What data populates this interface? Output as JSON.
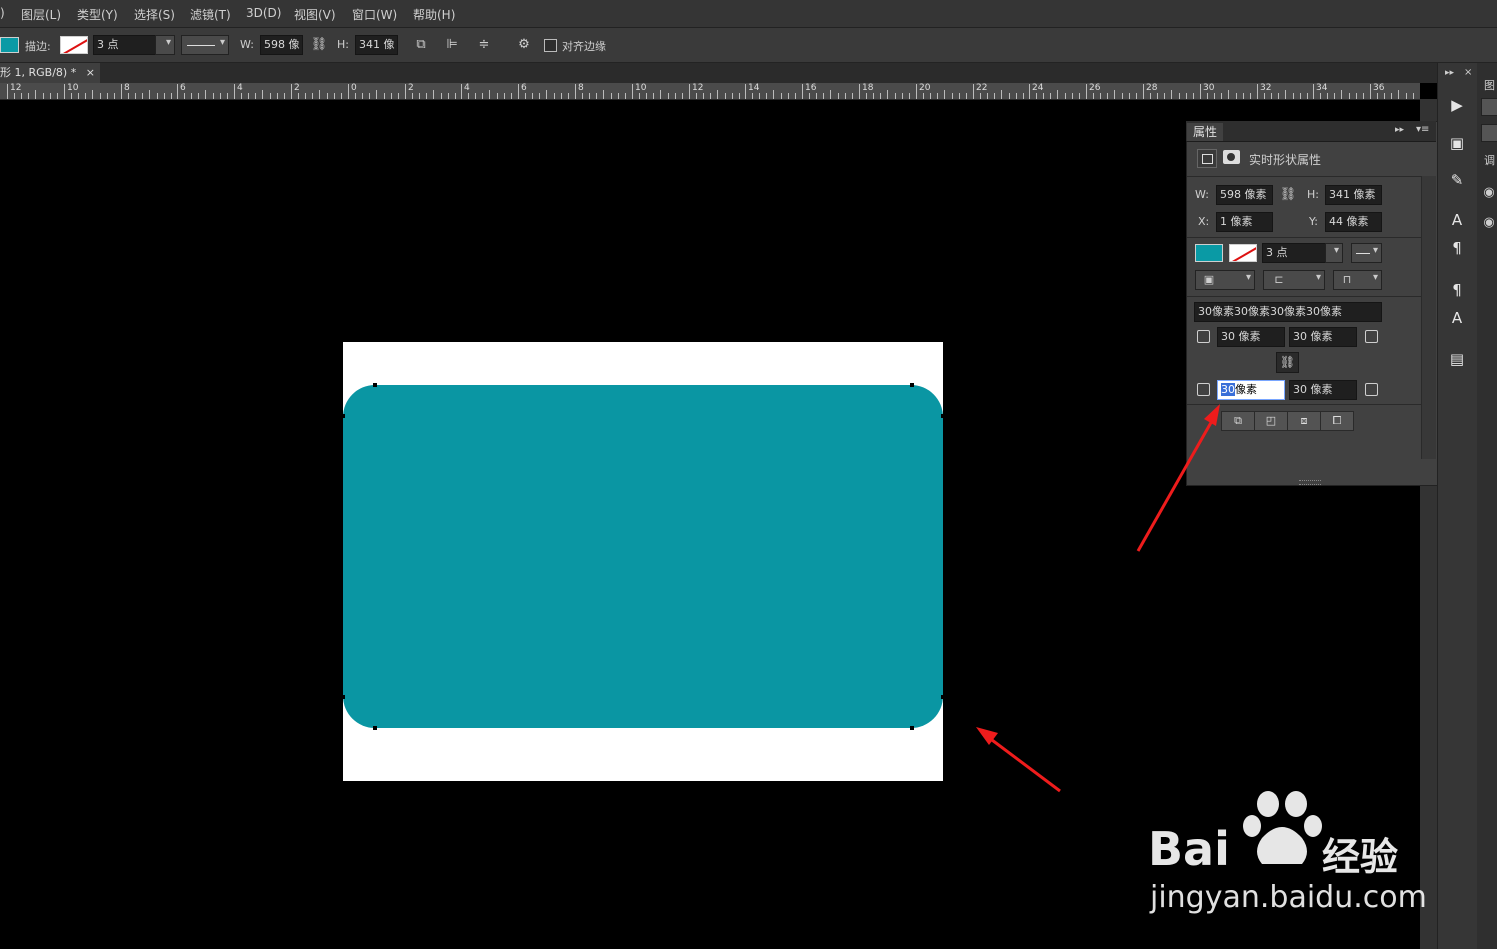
{
  "menu": {
    "items": [
      ")",
      "图层(L)",
      "类型(Y)",
      "选择(S)",
      "滤镜(T)",
      "3D(D)",
      "视图(V)",
      "窗口(W)",
      "帮助(H)"
    ]
  },
  "options": {
    "stroke_label": "描边:",
    "stroke_size": "3 点",
    "w_label": "W:",
    "w_value": "598 像",
    "h_label": "H:",
    "h_value": "341 像",
    "align_edges_label": "对齐边缘",
    "fill_color": "#0a9aa5"
  },
  "document": {
    "tab_title": "形 1, RGB/8) *",
    "close": "×",
    "shape_color": "#0a96a3"
  },
  "ruler": {
    "labels": [
      "12",
      "10",
      "8",
      "6",
      "4",
      "2",
      "0",
      "2",
      "4",
      "6",
      "8",
      "10",
      "12",
      "14",
      "16",
      "18",
      "20",
      "22",
      "24",
      "26",
      "28",
      "30",
      "32",
      "34",
      "36"
    ]
  },
  "dock": {
    "collapse": "▸▸",
    "close": "×",
    "far_label_1": "图",
    "far_label_2": "调"
  },
  "properties": {
    "tab": "属性",
    "title": "实时形状属性",
    "w_label": "W:",
    "w_value": "598 像素",
    "h_label": "H:",
    "h_value": "341 像素",
    "x_label": "X:",
    "x_value": "1 像素",
    "y_label": "Y:",
    "y_value": "44 像素",
    "stroke_size": "3 点",
    "corner_summary": "30像素30像素30像素30像素",
    "corner_tl": "30 像素",
    "corner_tr": "30 像素",
    "corner_bl_selected": "30",
    "corner_bl_rest": "像素",
    "corner_br": "30 像素"
  },
  "watermark": {
    "text": "jingyan.baidu.com",
    "brand": "Bai",
    "brand2": "经验"
  }
}
